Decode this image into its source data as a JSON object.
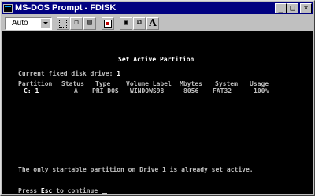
{
  "window": {
    "title": "MS-DOS Prompt - FDISK",
    "buttons": {
      "minimize": "_",
      "maximize": "□",
      "close": "×"
    }
  },
  "toolbar": {
    "font_size_value": "Auto",
    "font_button_label": "A",
    "icons": [
      "mark-icon",
      "copy-icon",
      "paste-icon",
      "fullscreen-icon",
      "properties-icon",
      "background-icon",
      "font-icon"
    ]
  },
  "screen": {
    "heading": "Set Active Partition",
    "current_drive_label": "Current fixed disk drive:",
    "current_drive_value": "1",
    "table": {
      "headers": [
        "Partition",
        "Status",
        "Type",
        "Volume Label",
        "Mbytes",
        "System",
        "Usage"
      ],
      "rows": [
        [
          "C: 1",
          "A",
          "PRI DOS",
          "WINDOWS98",
          "8056",
          "FAT32",
          "100%"
        ]
      ]
    },
    "message": "The only startable partition on Drive 1 is already set active.",
    "prompt_prefix": "Press",
    "prompt_key": "Esc",
    "prompt_suffix": "to continue"
  },
  "colors": {
    "titlebar": "#000080",
    "screen_bg": "#000000",
    "screen_text": "#c0c0c0",
    "screen_highlight": "#ffffff",
    "chrome": "#c0c0c0"
  }
}
